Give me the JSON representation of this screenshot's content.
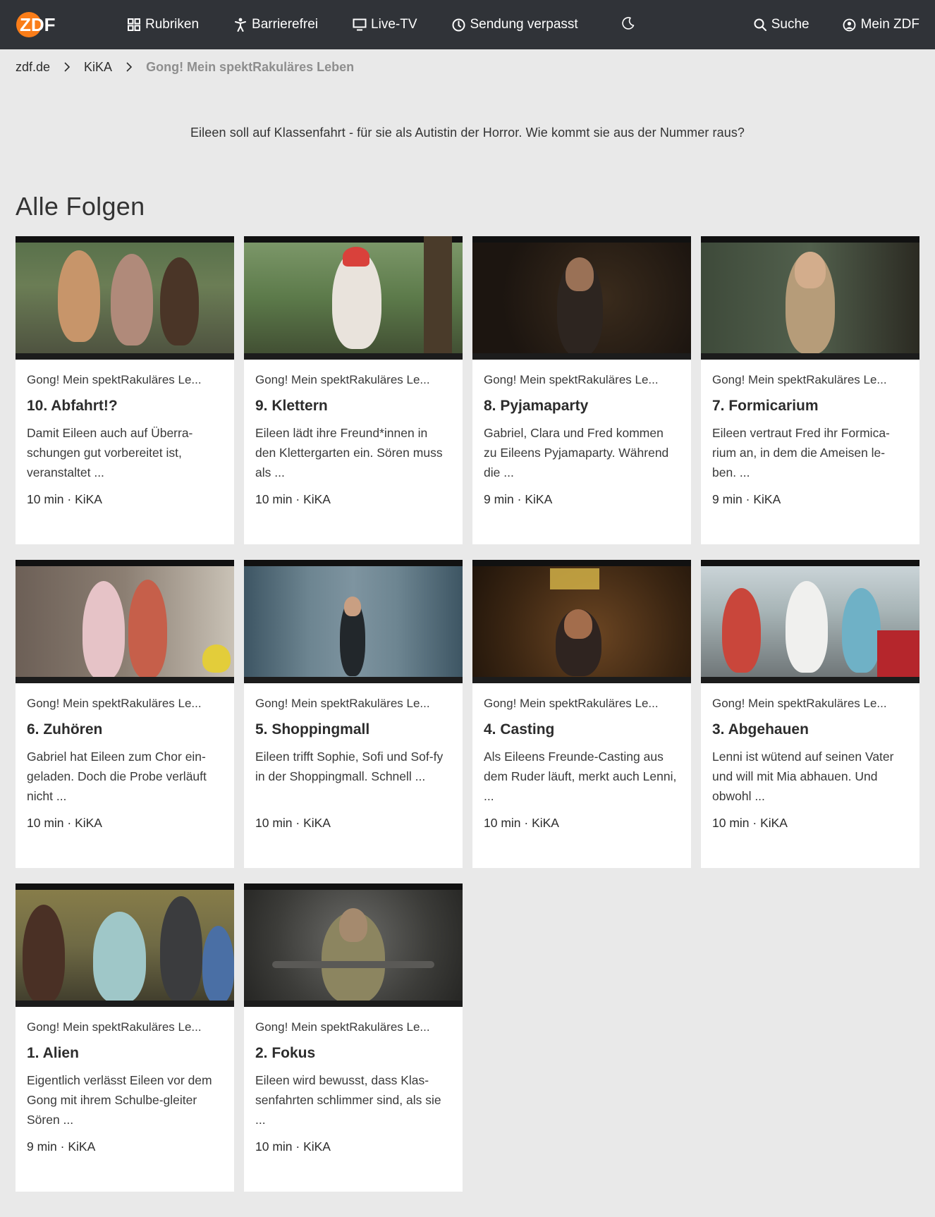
{
  "header": {
    "logo_text": "ZDF",
    "nav": [
      {
        "label": "Rubriken",
        "icon": "grid-icon"
      },
      {
        "label": "Barrierefrei",
        "icon": "accessibility-icon"
      },
      {
        "label": "Live-TV",
        "icon": "tv-icon"
      },
      {
        "label": "Sendung verpasst",
        "icon": "clock-icon"
      }
    ],
    "theme_icon": "moon-icon",
    "search_label": "Suche",
    "account_label": "Mein ZDF"
  },
  "breadcrumb": {
    "items": [
      "zdf.de",
      "KiKA"
    ],
    "current": "Gong! Mein spektRakuläres Leben"
  },
  "teaser": "Eileen soll auf Klassenfahrt - für sie als Autistin der Horror. Wie kommt sie aus der Nummer raus?",
  "section_title": "Alle Folgen",
  "colors": {
    "header_bg": "#303338",
    "accent": "#fa7d19",
    "page_bg": "#e9e9e9"
  },
  "episodes": [
    {
      "series": "Gong! Mein spektRakuläres Le...",
      "title": "10. Abfahrt!?",
      "desc": "Damit Eileen auch auf Überra-schungen gut vorbereitet ist, veranstaltet ...",
      "meta": "10 min · KiKA"
    },
    {
      "series": "Gong! Mein spektRakuläres Le...",
      "title": "9. Klettern",
      "desc": "Eileen lädt ihre Freund*innen in den Klettergarten ein. Sören muss als ...",
      "meta": "10 min · KiKA"
    },
    {
      "series": "Gong! Mein spektRakuläres Le...",
      "title": "8. Pyjamaparty",
      "desc": "Gabriel, Clara und Fred kommen zu Eileens Pyjamaparty. Während die ...",
      "meta": "9 min · KiKA"
    },
    {
      "series": "Gong! Mein spektRakuläres Le...",
      "title": "7. Formicarium",
      "desc": "Eileen vertraut Fred ihr Formica-rium an, in dem die Ameisen le-ben. ...",
      "meta": "9 min · KiKA"
    },
    {
      "series": "Gong! Mein spektRakuläres Le...",
      "title": "6. Zuhören",
      "desc": "Gabriel hat Eileen zum Chor ein-geladen. Doch die Probe verläuft nicht ...",
      "meta": "10 min · KiKA"
    },
    {
      "series": "Gong! Mein spektRakuläres Le...",
      "title": "5. Shoppingmall",
      "desc": "Eileen trifft Sophie, Sofi und Sof-fy in der Shoppingmall. Schnell ...",
      "meta": "10 min · KiKA"
    },
    {
      "series": "Gong! Mein spektRakuläres Le...",
      "title": "4. Casting",
      "desc": "Als Eileens Freunde-Casting aus dem Ruder läuft, merkt auch Lenni, ...",
      "meta": "10 min · KiKA"
    },
    {
      "series": "Gong! Mein spektRakuläres Le...",
      "title": "3. Abgehauen",
      "desc": "Lenni ist wütend auf seinen Vater und will mit Mia abhauen. Und obwohl ...",
      "meta": "10 min · KiKA"
    },
    {
      "series": "Gong! Mein spektRakuläres Le...",
      "title": "1. Alien",
      "desc": "Eigentlich verlässt Eileen vor dem Gong mit ihrem Schulbe-gleiter Sören ...",
      "meta": "9 min · KiKA"
    },
    {
      "series": "Gong! Mein spektRakuläres Le...",
      "title": "2. Fokus",
      "desc": "Eileen wird bewusst, dass Klas-senfahrten schlimmer sind, als sie ...",
      "meta": "10 min · KiKA"
    }
  ]
}
